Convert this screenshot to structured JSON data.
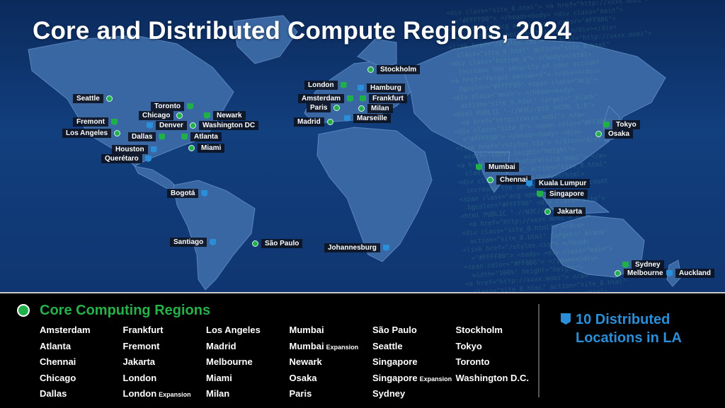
{
  "title": "Core and Distributed Compute Regions, 2024",
  "colors": {
    "core_green": "#21b04b",
    "distributed_blue": "#2a8fd8",
    "map_background": "#123f7e",
    "label_background": "#0c121e"
  },
  "icons": {
    "core_marker": "green-dot-icon",
    "expansion_marker": "green-flag-icon",
    "distributed_marker": "blue-flag-icon"
  },
  "map_labels": [
    {
      "name": "Seattle",
      "marker": "dot"
    },
    {
      "name": "Toronto",
      "marker": "flag-g"
    },
    {
      "name": "Fremont",
      "marker": "flag-g"
    },
    {
      "name": "Chicago",
      "marker": "dot"
    },
    {
      "name": "Newark",
      "marker": "flag-g"
    },
    {
      "name": "Denver",
      "marker": "flag-b"
    },
    {
      "name": "Washington DC",
      "marker": "dot"
    },
    {
      "name": "Los Angeles",
      "marker": "dot"
    },
    {
      "name": "Dallas",
      "marker": "flag-g"
    },
    {
      "name": "Atlanta",
      "marker": "flag-g"
    },
    {
      "name": "Houston",
      "marker": "flag-b"
    },
    {
      "name": "Miami",
      "marker": "dot"
    },
    {
      "name": "Querétaro",
      "marker": "flag-b"
    },
    {
      "name": "Bogotá",
      "marker": "flag-b"
    },
    {
      "name": "Santiago",
      "marker": "flag-b"
    },
    {
      "name": "São Paulo",
      "marker": "dot"
    },
    {
      "name": "Stockholm",
      "marker": "dot"
    },
    {
      "name": "London",
      "marker": "flag-g"
    },
    {
      "name": "Hamburg",
      "marker": "flag-b"
    },
    {
      "name": "Amsterdam",
      "marker": "flag-g"
    },
    {
      "name": "Frankfurt",
      "marker": "flag-g"
    },
    {
      "name": "Paris",
      "marker": "dot"
    },
    {
      "name": "Milan",
      "marker": "dot"
    },
    {
      "name": "Madrid",
      "marker": "dot"
    },
    {
      "name": "Marseille",
      "marker": "flag-b"
    },
    {
      "name": "Johannesburg",
      "marker": "flag-b"
    },
    {
      "name": "Mumbai",
      "marker": "flag-g"
    },
    {
      "name": "Chennai",
      "marker": "dot"
    },
    {
      "name": "Kuala Lumpur",
      "marker": "flag-b"
    },
    {
      "name": "Singapore",
      "marker": "flag-g"
    },
    {
      "name": "Jakarta",
      "marker": "dot"
    },
    {
      "name": "Tokyo",
      "marker": "flag-g"
    },
    {
      "name": "Osaka",
      "marker": "dot"
    },
    {
      "name": "Sydney",
      "marker": "flag-g"
    },
    {
      "name": "Melbourne",
      "marker": "dot"
    },
    {
      "name": "Auckland",
      "marker": "flag-b"
    }
  ],
  "legend": {
    "core_title": "Core Computing Regions",
    "regions": [
      {
        "name": "Amsterdam",
        "suffix": ""
      },
      {
        "name": "Atlanta",
        "suffix": ""
      },
      {
        "name": "Chennai",
        "suffix": ""
      },
      {
        "name": "Chicago",
        "suffix": ""
      },
      {
        "name": "Dallas",
        "suffix": ""
      },
      {
        "name": "Frankfurt",
        "suffix": ""
      },
      {
        "name": "Fremont",
        "suffix": ""
      },
      {
        "name": "Jakarta",
        "suffix": ""
      },
      {
        "name": "London",
        "suffix": ""
      },
      {
        "name": "London",
        "suffix": "Expansion"
      },
      {
        "name": "Los Angeles",
        "suffix": ""
      },
      {
        "name": "Madrid",
        "suffix": ""
      },
      {
        "name": "Melbourne",
        "suffix": ""
      },
      {
        "name": "Miami",
        "suffix": ""
      },
      {
        "name": "Milan",
        "suffix": ""
      },
      {
        "name": "Mumbai",
        "suffix": ""
      },
      {
        "name": "Mumbai",
        "suffix": "Expansion"
      },
      {
        "name": "Newark",
        "suffix": ""
      },
      {
        "name": "Osaka",
        "suffix": ""
      },
      {
        "name": "Paris",
        "suffix": ""
      },
      {
        "name": "São Paulo",
        "suffix": ""
      },
      {
        "name": "Seattle",
        "suffix": ""
      },
      {
        "name": "Singapore",
        "suffix": ""
      },
      {
        "name": "Singapore",
        "suffix": "Expansion"
      },
      {
        "name": "Sydney",
        "suffix": ""
      },
      {
        "name": "Stockholm",
        "suffix": ""
      },
      {
        "name": "Tokyo",
        "suffix": ""
      },
      {
        "name": "Toronto",
        "suffix": ""
      },
      {
        "name": "Washington D.C.",
        "suffix": ""
      }
    ],
    "distributed_line1": "10 Distributed",
    "distributed_line2": "Locations in LA"
  }
}
